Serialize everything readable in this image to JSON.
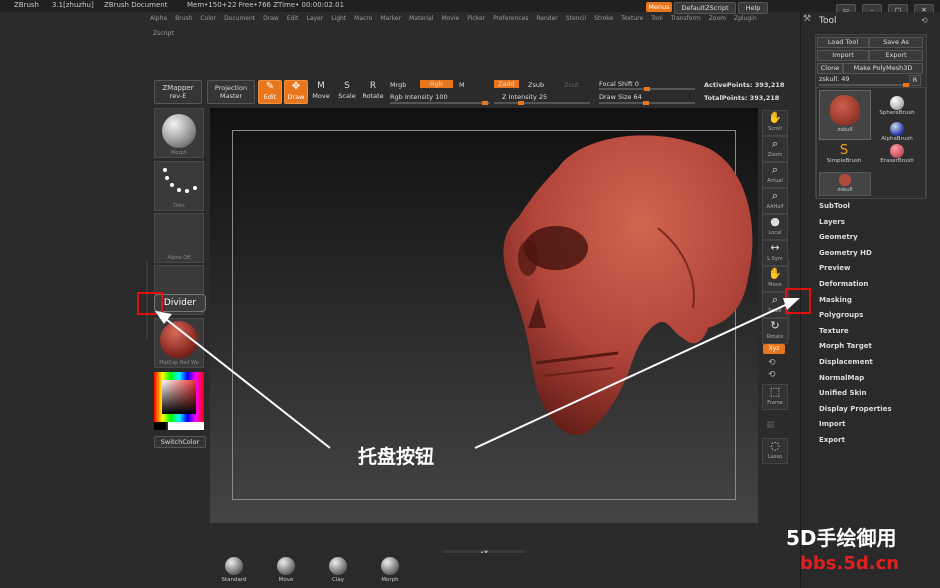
{
  "titlebar": {
    "app": "ZBrush",
    "version": "3.1[zhuzhu]",
    "doc": "ZBrush Document",
    "mem": "Mem•150+22 Free•766 ZTime• 00:00:02.01"
  },
  "topright": {
    "menus": "Menus",
    "script": "DefaultZScript",
    "help": "Help"
  },
  "menubar": [
    "Alpha",
    "Brush",
    "Color",
    "Document",
    "Draw",
    "Edit",
    "Layer",
    "Light",
    "Macro",
    "Marker",
    "Material",
    "Movie",
    "Picker",
    "Preferences",
    "Render",
    "Stencil",
    "Stroke",
    "Texture",
    "Tool",
    "Transform",
    "Zoom",
    "Zplugin"
  ],
  "menubar2": "Zscript",
  "toolbar": {
    "zmapper": "ZMapper",
    "zmapper_sub": "rev-E",
    "projection": "Projection",
    "projection_sub": "Master",
    "edit": "Edit",
    "draw": "Draw",
    "move": "Move",
    "scale": "Scale",
    "rotate": "Rotate",
    "mrgb": "Mrgb",
    "rgb": "Rgb",
    "m": "M",
    "rgb_intensity": "Rgb Intensity 100",
    "zadd": "Zadd",
    "zsub": "Zsub",
    "zcut": "Zcut",
    "z_intensity": "Z Intensity 25",
    "focal_shift": "Focal Shift 0",
    "draw_size": "Draw Size 64",
    "active_points": "ActivePoints: 393,218",
    "total_points": "TotalPoints: 393,218"
  },
  "leftpanel": {
    "morph": "Morph",
    "dots": "Dots",
    "alpha": "Alpha Off",
    "divider": "Divider",
    "matcap": "MatCap Red Wa",
    "switch_color": "SwitchColor"
  },
  "rightbar": [
    {
      "icon": "✋",
      "label": "Scroll"
    },
    {
      "icon": "⌕",
      "label": "Zoom"
    },
    {
      "icon": "⌕",
      "label": "Actual"
    },
    {
      "icon": "⌕",
      "label": "AAHalf"
    },
    {
      "icon": "●",
      "label": "Local"
    },
    {
      "icon": "↔",
      "label": "L.Sym"
    },
    {
      "icon": "✋",
      "label": "Move"
    },
    {
      "icon": "⌕",
      "label": "Scale"
    },
    {
      "icon": "↻",
      "label": "Rotate"
    }
  ],
  "rightbar_lower": {
    "xyz": "Xyz",
    "frame": "Frame",
    "lasso": "Lasso"
  },
  "tool": {
    "title": "Tool",
    "load": "Load Tool",
    "save": "Save As",
    "import": "Import",
    "export": "Export",
    "clone": "Clone",
    "make": "Make PolyMesh3D",
    "current": "zskull. 49",
    "r": "R",
    "brushes": [
      {
        "label": "zskull"
      },
      {
        "label": "SphereBrush"
      },
      {
        "label": "AlphaBrush"
      },
      {
        "label": "SimpleBrush"
      },
      {
        "label": "EraserBrush"
      },
      {
        "label": "zskull"
      }
    ],
    "items": [
      "SubTool",
      "Layers",
      "Geometry",
      "Geometry HD",
      "Preview",
      "Deformation",
      "Masking",
      "Polygroups",
      "Texture",
      "Morph Target",
      "Displacement",
      "NormalMap",
      "Unified Skin",
      "Display Properties",
      "Import",
      "Export"
    ]
  },
  "bottom_brushes": [
    "Standard",
    "Move",
    "Clay",
    "Morph"
  ],
  "annotation": "托盘按钮",
  "watermark": {
    "line1": "5D手绘御用",
    "line2": "bbs.5d.cn"
  },
  "colors": {
    "accent": "#e8761c",
    "skull": "#b5473a",
    "annot_red": "#e01010"
  }
}
